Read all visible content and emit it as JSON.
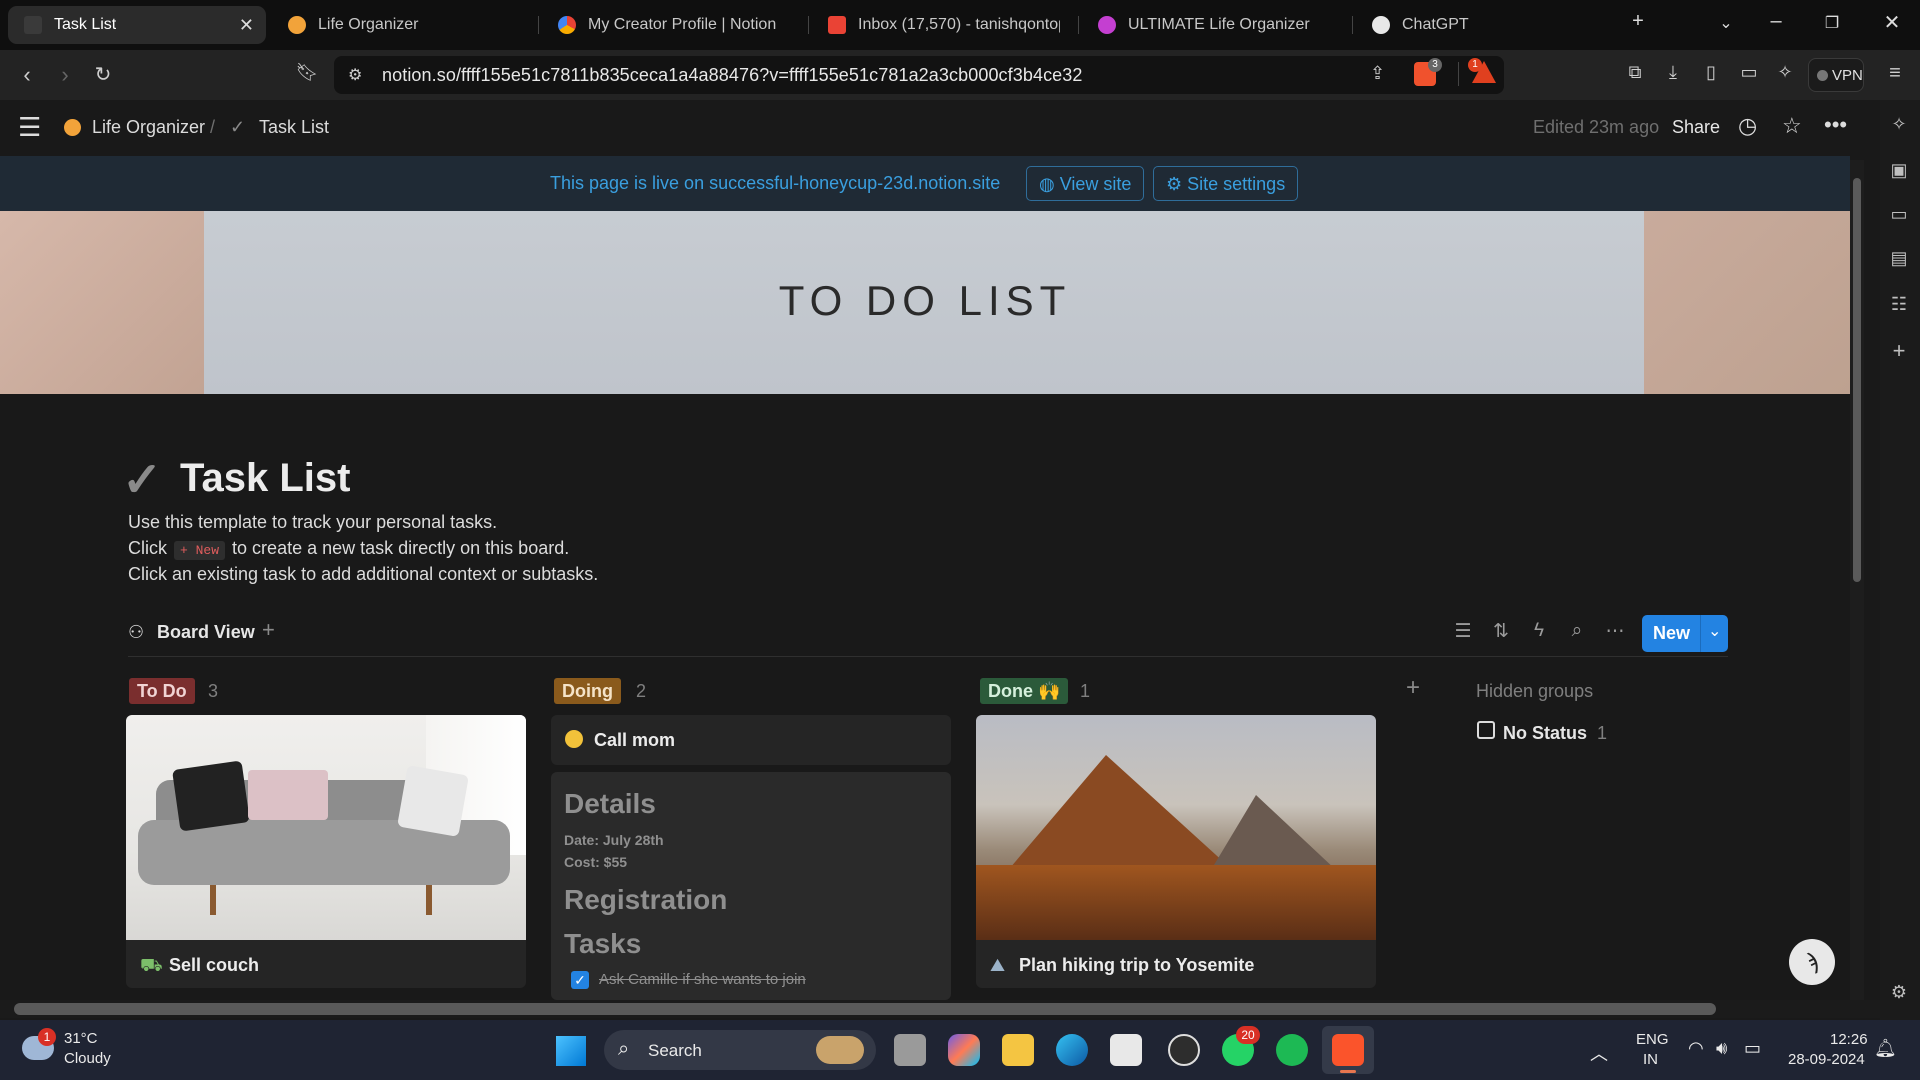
{
  "browser": {
    "tabs": [
      {
        "title": "Task List",
        "active": true
      },
      {
        "title": "Life Organizer",
        "active": false
      },
      {
        "title": "My Creator Profile | Notion",
        "active": false
      },
      {
        "title": "Inbox (17,570) - tanishqontop@",
        "active": false
      },
      {
        "title": "ULTIMATE Life Organizer",
        "active": false
      },
      {
        "title": "ChatGPT",
        "active": false
      }
    ],
    "url": "notion.so/ffff155e51c7811b835ceca1a4a88476?v=ffff155e51c781a2a3cb000cf3b4ce32",
    "shields_badge": "3",
    "rewards_badge": "1",
    "vpn_label": "VPN"
  },
  "notion": {
    "breadcrumb": {
      "parent": "Life Organizer",
      "separator": "/",
      "current": "Task List"
    },
    "edited": "Edited 23m ago",
    "share_label": "Share",
    "banner": {
      "text": "This page is live on successful-honeycup-23d.notion.site",
      "view_site": "View site",
      "site_settings": "Site settings"
    },
    "cover_text": "TO DO LIST",
    "page_icon": "✓",
    "title": "Task List",
    "description": {
      "line1": "Use this template to track your personal tasks.",
      "line2_before": "Click",
      "line2_chip": "+ New",
      "line2_after": "to create a new task directly on this board.",
      "line3": "Click an existing task to add additional context or subtasks."
    },
    "view_tab": "Board View",
    "new_button": "New",
    "columns": [
      {
        "label": "To Do",
        "count": "3",
        "color": "#7a2e2e",
        "text_color": "#f1d4d4"
      },
      {
        "label": "Doing",
        "count": "2",
        "color": "#8a5a1c",
        "text_color": "#f5e3c8"
      },
      {
        "label": "Done 🙌",
        "count": "1",
        "color": "#2b5a3a",
        "text_color": "#d5f0dc"
      }
    ],
    "cards": {
      "sell_couch": "Sell couch",
      "call_mom": "Call mom",
      "details_heading": "Details",
      "date_line": "Date: July 28th",
      "cost_line": "Cost: $55",
      "registration_heading": "Registration",
      "tasks_heading": "Tasks",
      "subtask": "Ask Camille if she wants to join",
      "hiking": "Plan hiking trip to Yosemite"
    },
    "hidden_groups": {
      "label": "Hidden groups",
      "item": "No Status",
      "count": "1"
    }
  },
  "taskbar": {
    "weather_temp": "31°C",
    "weather_desc": "Cloudy",
    "weather_badge": "1",
    "search_label": "Search",
    "whatsapp_badge": "20",
    "lang_top": "ENG",
    "lang_bottom": "IN",
    "time": "12:26",
    "date": "28-09-2024"
  }
}
